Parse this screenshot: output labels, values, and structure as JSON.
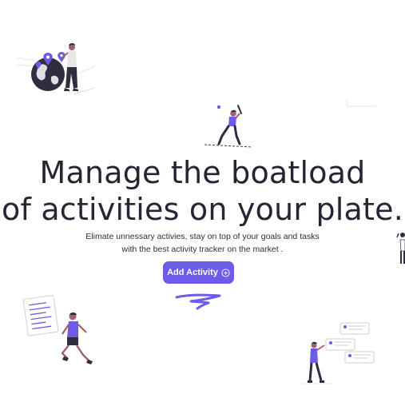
{
  "hero": {
    "headline_line1": "Manage the boatload",
    "headline_line2": "of activities on your plate.",
    "subtitle_line1": "Elimate unnessary activies, stay on top of your goals and tasks",
    "subtitle_line2": "with the best activity tracker on the market .",
    "cta_label": "Add Activity",
    "cta_icon": "plus-circle-icon"
  },
  "colors": {
    "accent": "#6c5ce7",
    "text": "#242633",
    "skin": "#a0616a",
    "dark": "#2f2e41"
  }
}
